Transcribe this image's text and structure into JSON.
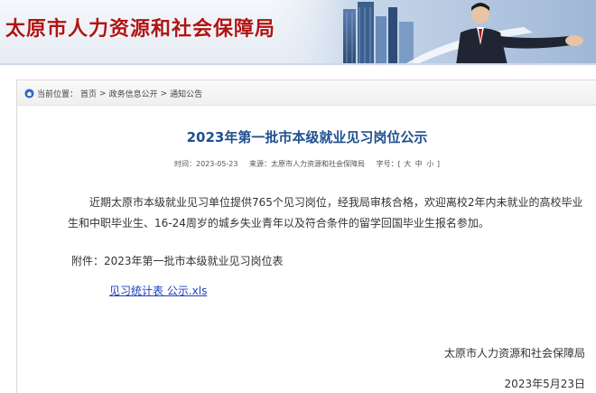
{
  "header": {
    "site_title": "太原市人力资源和社会保障局"
  },
  "breadcrumb": {
    "prefix": "当前位置：",
    "items": [
      "首页",
      "政务信息公开",
      "通知公告"
    ],
    "separator": ">"
  },
  "article": {
    "title": "2023年第一批市本级就业见习岗位公示",
    "meta": {
      "time_label": "时间：",
      "time_value": "2023-05-23",
      "source_label": "来源：",
      "source_value": "太原市人力资源和社会保障局",
      "fontsize_label": "字号：",
      "fontsize_open": "[",
      "fontsize_large": "大",
      "fontsize_medium": "中",
      "fontsize_small": "小",
      "fontsize_close": "]"
    },
    "body": "近期太原市本级就业见习单位提供765个见习岗位，经我局审核合格，欢迎离校2年内未就业的高校毕业生和中职毕业生、16-24周岁的城乡失业青年以及符合条件的留学回国毕业生报名参加。",
    "attachment_line": "附件：2023年第一批市本级就业见习岗位表",
    "attachment_link": "见习统计表 公示.xls",
    "signature_org": "太原市人力资源和社会保障局",
    "signature_date": "2023年5月23日"
  },
  "colors": {
    "site_title": "#b01414",
    "article_title": "#1f4f8f",
    "link": "#1a3fbf"
  },
  "icons": {
    "breadcrumb": "home-icon"
  }
}
